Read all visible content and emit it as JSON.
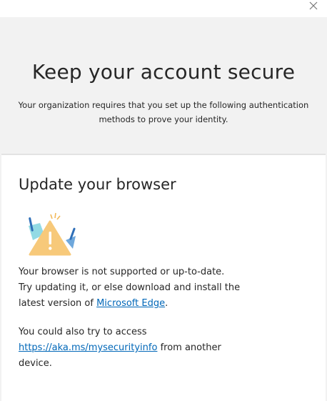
{
  "window": {
    "close_icon": "close-icon"
  },
  "header": {
    "title": "Keep your account secure",
    "subtitle_line1": "Your organization requires that you set up the following authentication",
    "subtitle_line2": "methods to prove your identity."
  },
  "card": {
    "heading": "Update your browser",
    "illustration_icon": "warning-illustration-icon",
    "message": {
      "line1": "Your browser is not supported or up-to-date.",
      "line2": "Try updating it, or else download and install the",
      "line3_prefix": "latest version of ",
      "edge_link": "Microsoft Edge",
      "line3_suffix": "."
    },
    "alt_message": {
      "line1": "You could also try to access",
      "link": "https://aka.ms/mysecurityinfo",
      "line2_suffix": " from another",
      "line3": "device."
    }
  },
  "colors": {
    "link": "#0067b8",
    "warning": "#f7c97a",
    "accent_teal": "#69c9d8",
    "accent_blue": "#2f6fb8"
  }
}
